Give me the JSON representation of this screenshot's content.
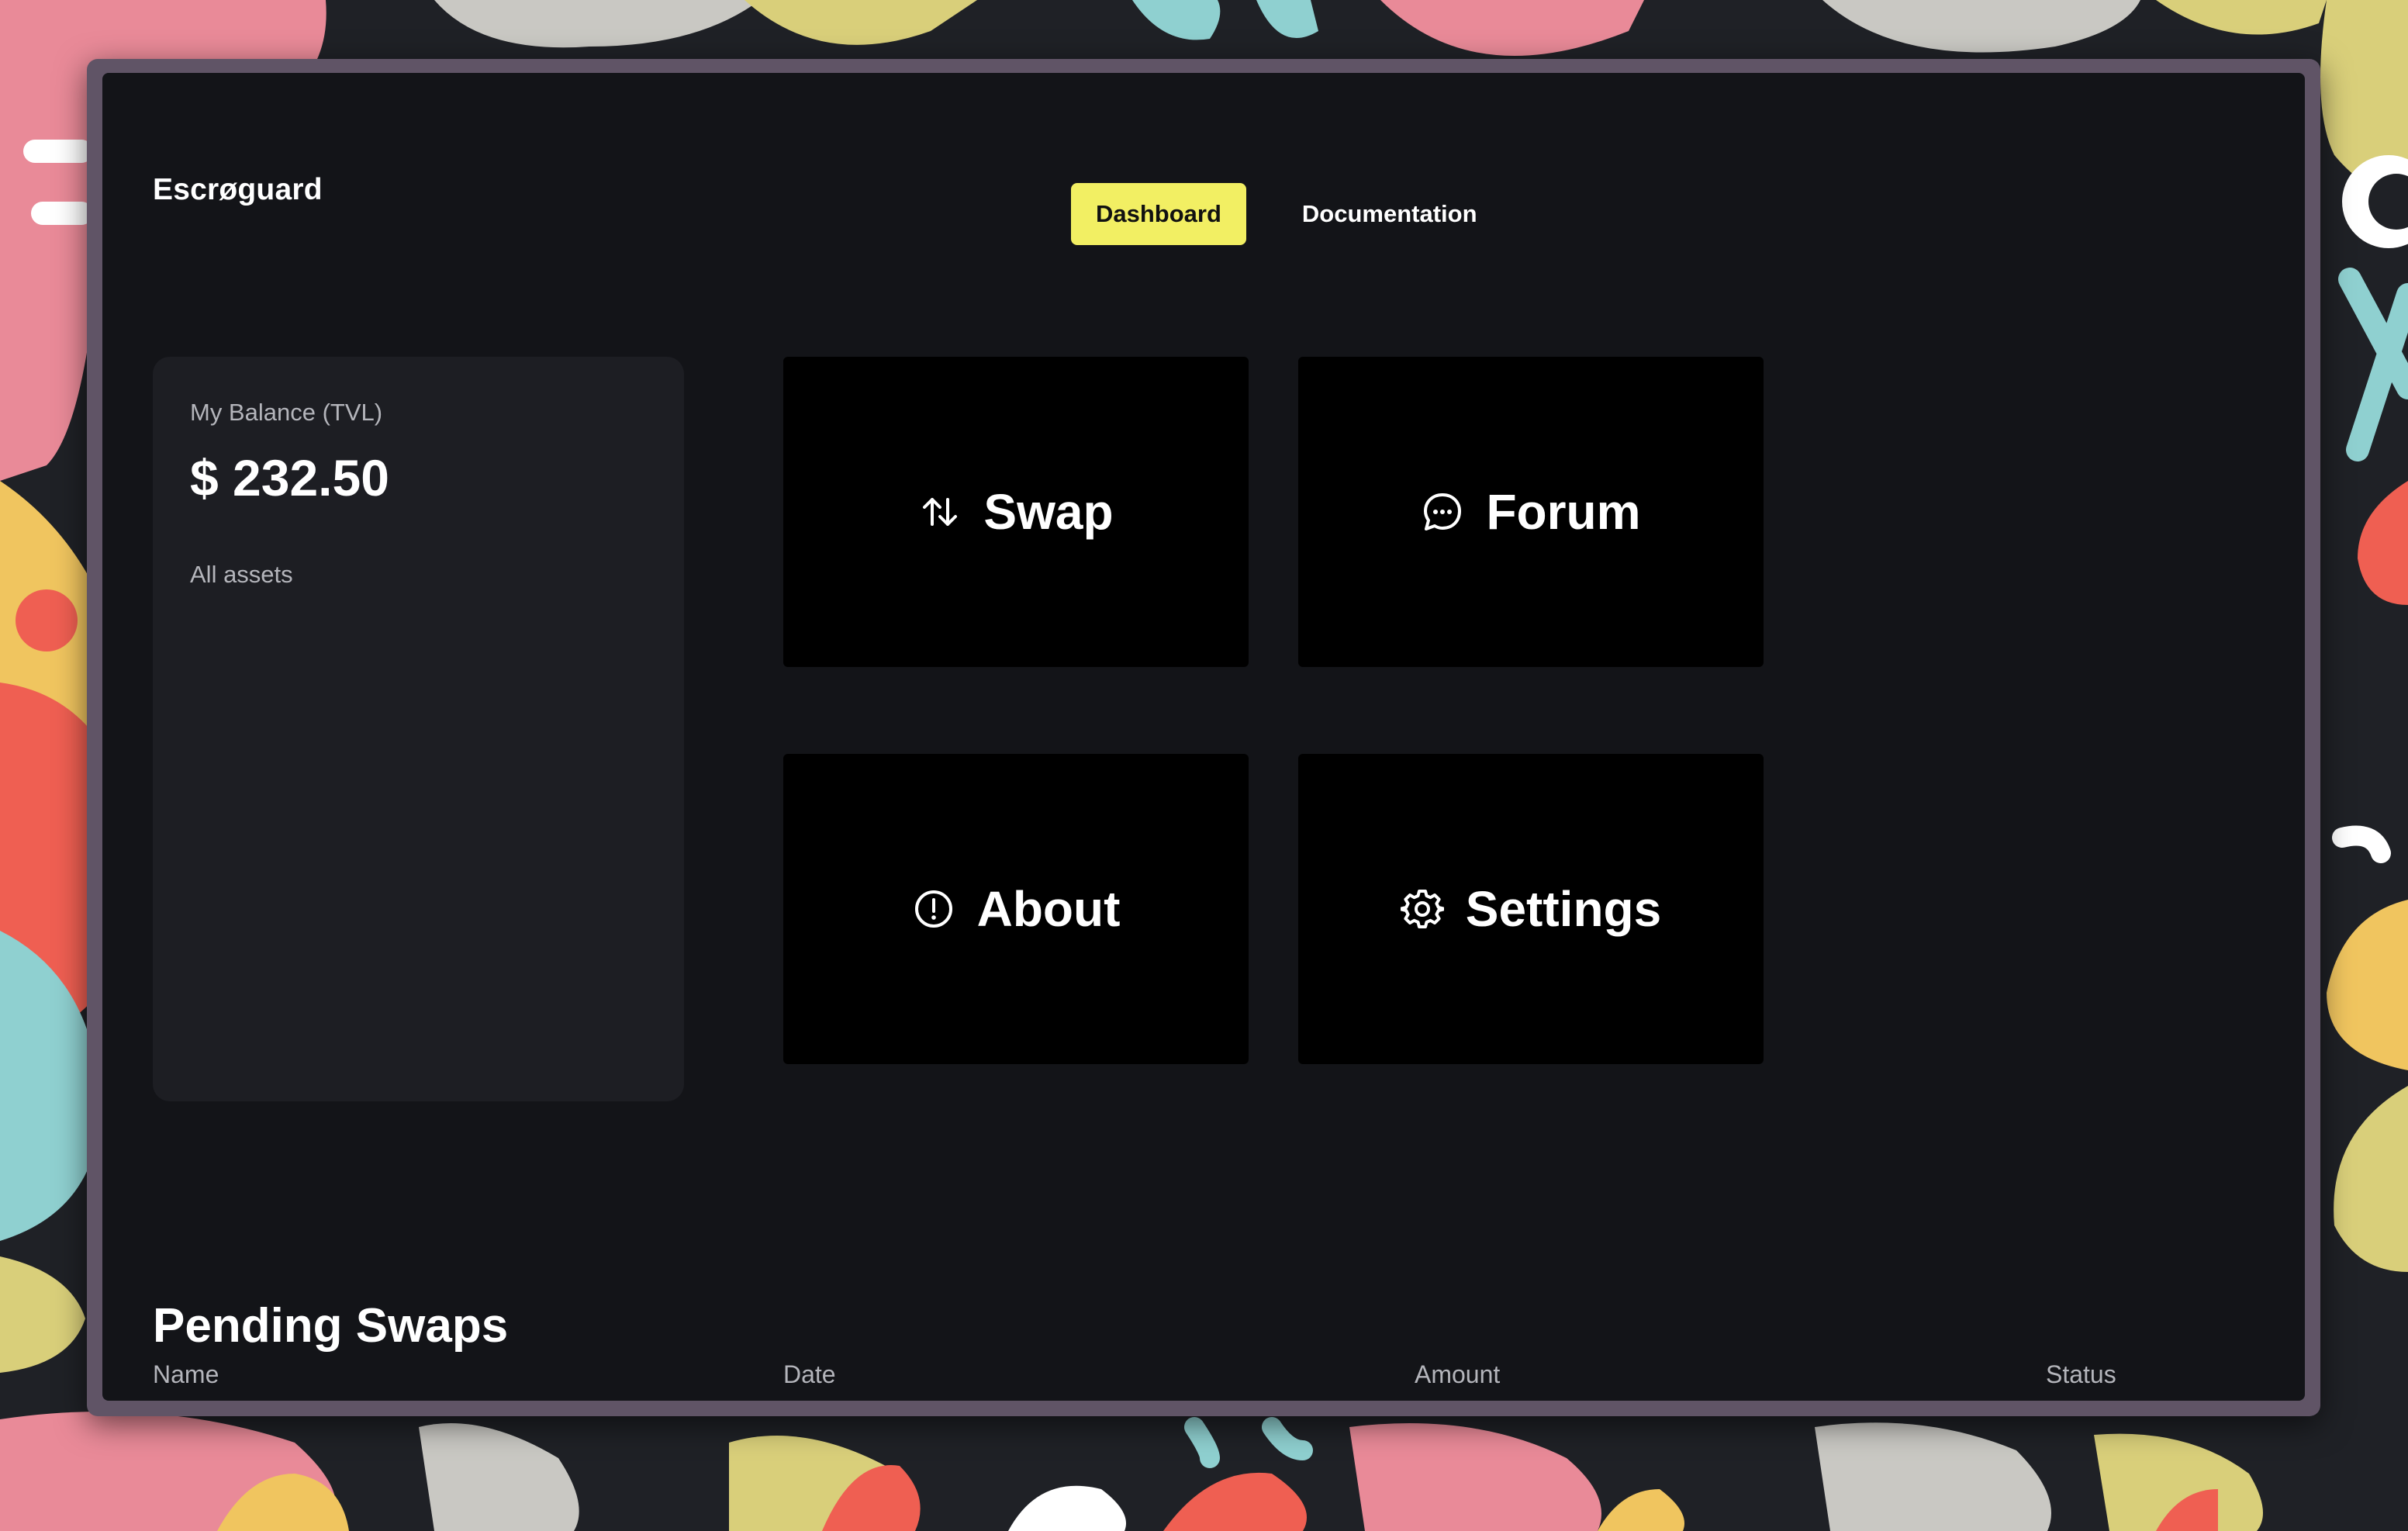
{
  "header": {
    "brand": "Escrøguard",
    "nav": {
      "dashboard": "Dashboard",
      "documentation": "Documentation"
    },
    "active_tab": "Dashboard"
  },
  "balance": {
    "label": "My Balance (TVL)",
    "value": "$ 232.50",
    "assets_label": "All assets"
  },
  "tiles": {
    "swap": {
      "label": "Swap",
      "icon": "swap-arrows-icon"
    },
    "forum": {
      "label": "Forum",
      "icon": "chat-bubble-icon"
    },
    "about": {
      "label": "About",
      "icon": "info-circle-icon"
    },
    "settings": {
      "label": "Settings",
      "icon": "gear-icon"
    }
  },
  "pending": {
    "title": "Pending Swaps",
    "columns": {
      "name": "Name",
      "date": "Date",
      "amount": "Amount",
      "status": "Status"
    }
  },
  "colors": {
    "accent": "#f2ef63",
    "app_background": "#131418",
    "card_background": "#1d1e23",
    "tile_background": "#000000",
    "window_frame": "#605466"
  }
}
